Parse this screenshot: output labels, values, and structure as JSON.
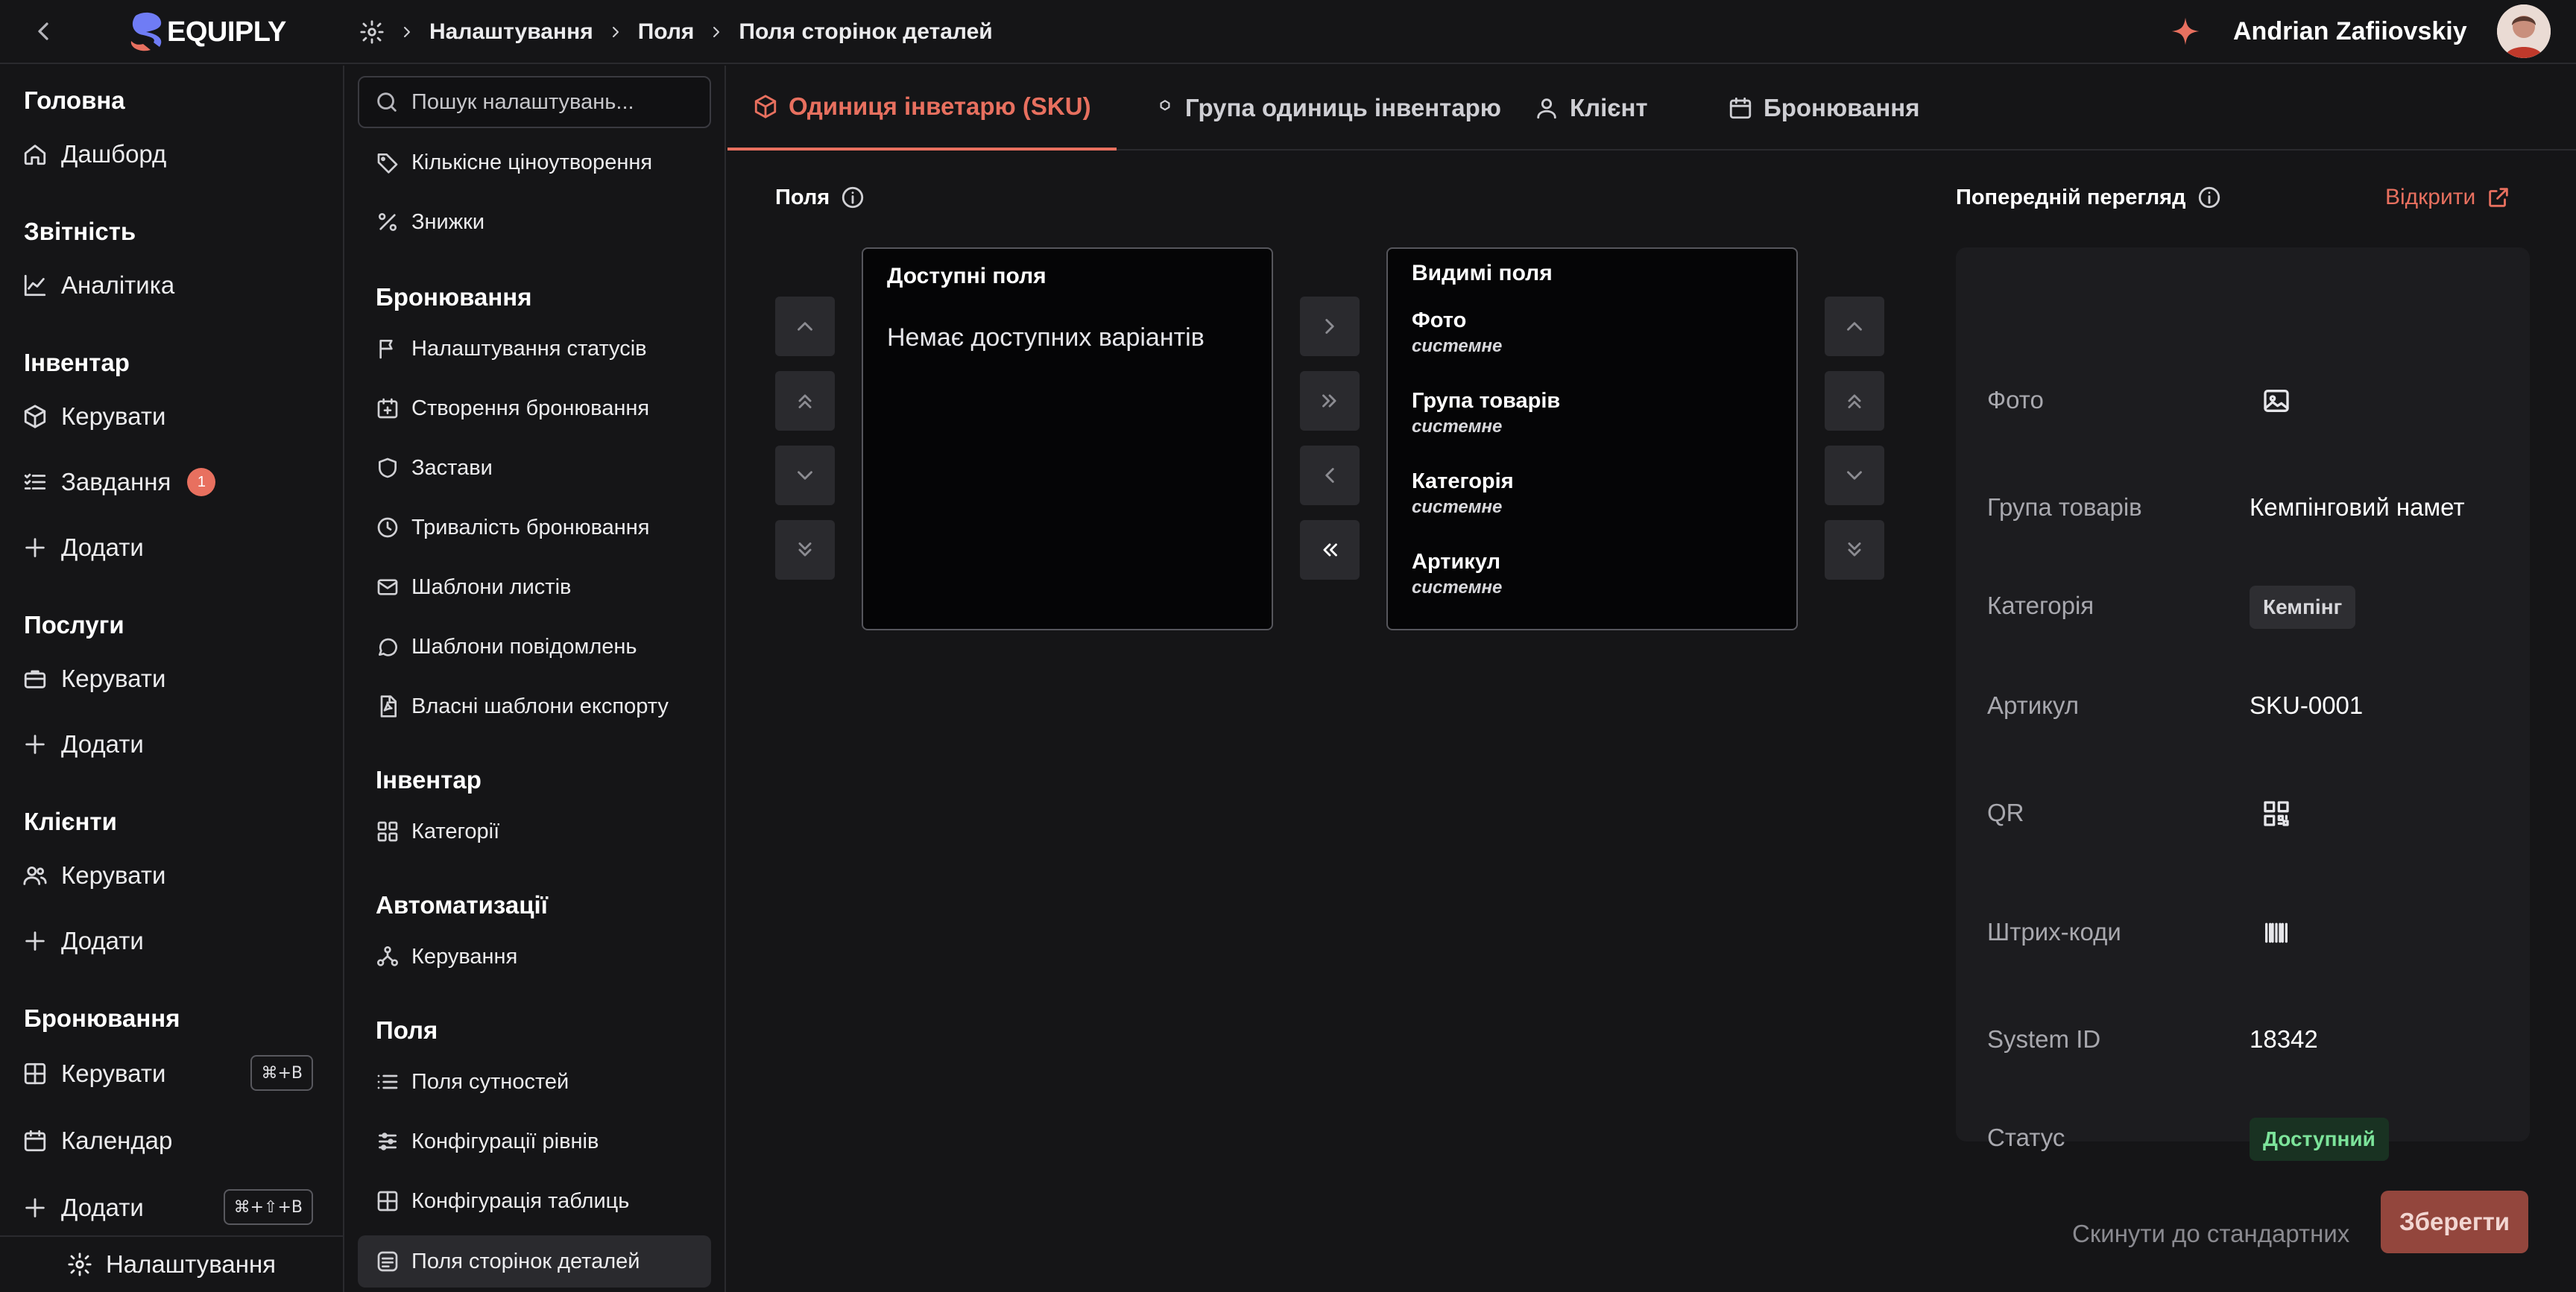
{
  "brand": {
    "name": "EQUIPLY",
    "accent": "#e8705f"
  },
  "breadcrumb": [
    "Налаштування",
    "Поля",
    "Поля сторінок деталей"
  ],
  "user": {
    "name": "Andrian Zafiiovskiy"
  },
  "nav": {
    "sections": [
      {
        "title": "Головна",
        "items": [
          {
            "label": "Дашборд",
            "icon": "home-icon"
          }
        ]
      },
      {
        "title": "Звітність",
        "items": [
          {
            "label": "Аналітика",
            "icon": "chart-icon"
          }
        ]
      },
      {
        "title": "Інвентар",
        "items": [
          {
            "label": "Керувати",
            "icon": "box-icon"
          },
          {
            "label": "Завдання",
            "icon": "list-check-icon",
            "badge": "1"
          },
          {
            "label": "Додати",
            "icon": "plus-icon"
          }
        ]
      },
      {
        "title": "Послуги",
        "items": [
          {
            "label": "Керувати",
            "icon": "briefcase-icon"
          },
          {
            "label": "Додати",
            "icon": "plus-icon"
          }
        ]
      },
      {
        "title": "Клієнти",
        "items": [
          {
            "label": "Керувати",
            "icon": "users-icon"
          },
          {
            "label": "Додати",
            "icon": "plus-icon"
          }
        ]
      },
      {
        "title": "Бронювання",
        "items": [
          {
            "label": "Керувати",
            "icon": "table-icon",
            "shortcut": "⌘+B"
          },
          {
            "label": "Календар",
            "icon": "calendar-icon"
          },
          {
            "label": "Додати",
            "icon": "plus-icon",
            "shortcut": "⌘+⇧+B"
          }
        ]
      }
    ],
    "settings_label": "Налаштування"
  },
  "settings_menu": {
    "search_placeholder": "Пошук налаштувань...",
    "top_items": [
      {
        "label": "Кількісне ціноутворення"
      },
      {
        "label": "Знижки"
      }
    ],
    "groups": [
      {
        "title": "Бронювання",
        "items": [
          "Налаштування статусів",
          "Створення бронювання",
          "Застави",
          "Тривалість бронювання",
          "Шаблони листів",
          "Шаблони повідомлень",
          "Власні шаблони експорту"
        ]
      },
      {
        "title": "Інвентар",
        "items": [
          "Категорії"
        ]
      },
      {
        "title": "Автоматизації",
        "items": [
          "Керування"
        ]
      },
      {
        "title": "Поля",
        "items": [
          "Поля сутностей",
          "Конфігурації рівнів",
          "Конфігурація таблиць",
          "Поля сторінок деталей"
        ]
      }
    ]
  },
  "tabs": [
    {
      "label": "Одиниця інветарю (SKU)",
      "active": true
    },
    {
      "label": "Група одиниць інвентарю"
    },
    {
      "label": "Клієнт"
    },
    {
      "label": "Бронювання"
    }
  ],
  "fields": {
    "label": "Поля",
    "available_title": "Доступні поля",
    "available_empty": "Немає доступних варіантів",
    "visible_title": "Видимі поля",
    "visible": [
      {
        "name": "Фото",
        "type": "системне"
      },
      {
        "name": "Група товарів",
        "type": "системне"
      },
      {
        "name": "Категорія",
        "type": "системне"
      },
      {
        "name": "Артикул",
        "type": "системне"
      }
    ]
  },
  "preview": {
    "label": "Попередній перегляд",
    "open_label": "Відкрити",
    "rows": [
      {
        "label": "Фото",
        "icon": "image-icon"
      },
      {
        "label": "Група товарів",
        "value": "Кемпінговий намет"
      },
      {
        "label": "Категорія",
        "chip": "Кемпінг"
      },
      {
        "label": "Артикул",
        "value": "SKU-0001"
      },
      {
        "label": "QR",
        "icon": "qr-icon"
      },
      {
        "label": "Штрих-коди",
        "icon": "barcode-icon"
      },
      {
        "label": "System ID",
        "value": "18342"
      },
      {
        "label": "Статус",
        "chip": "Доступний"
      }
    ]
  },
  "actions": {
    "reset": "Скинути до стандартних",
    "save": "Зберегти"
  }
}
